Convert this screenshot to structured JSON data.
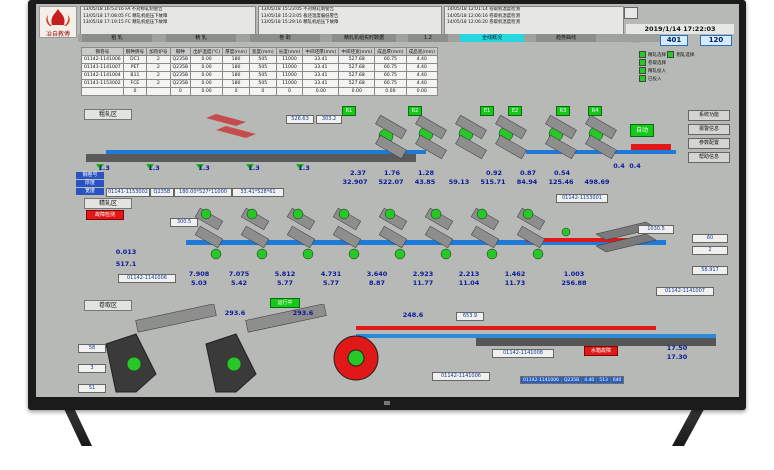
{
  "brand": {
    "logo_text": "冶自教傅"
  },
  "alarms": {
    "col1": [
      "13/05/18 16:53:16 FA 不对称轧制警告",
      "13/05/18 17:08:05 FC 精轧机组压下故障",
      "13/05/18 17:19:15 FC 精轧机组压下故障"
    ],
    "col2": [
      "13/05/18 15:23:05 不对称轧制警告",
      "13/05/18 15:23:05 板坯温度偏低警告",
      "13/05/18 15:29:16 精轧机组压下故障"
    ],
    "col3": [
      "14/05/18 12:01:14 卷取机温度检测",
      "14/05/18 12:06:16 卷取机温度检测",
      "14/05/18 12:06:20 卷取机温度检测"
    ]
  },
  "clock": {
    "date_time": "2019/1/14 17:22:03",
    "label": "计数",
    "count_a": "401",
    "count_b": "120"
  },
  "tabs": [
    {
      "label": "粗 轧",
      "active": false
    },
    {
      "label": "精 轧",
      "active": false
    },
    {
      "label": "卷 取",
      "active": false
    },
    {
      "label": "精轧机组实时数据",
      "active": false
    },
    {
      "label": "1.2",
      "active": false
    },
    {
      "label": "全线概况",
      "active": true
    },
    {
      "label": "趋势曲线",
      "active": false
    }
  ],
  "table": {
    "headers": [
      "钢卷号",
      "钢种牌号",
      "加热炉号",
      "钢种",
      "出炉温度(℃)",
      "厚度(mm)",
      "宽度(mm)",
      "长度(mm)",
      "中间坯厚(mm)",
      "中间坯宽(mm)",
      "成品厚(mm)",
      "成品宽(mm)"
    ],
    "rows": [
      [
        "01142-1141006",
        "DC1",
        "2",
        "Q235B",
        "0.00",
        "180",
        "505",
        "11000",
        "33.41",
        "527.68",
        "60.75",
        "4.40",
        "513.00"
      ],
      [
        "01141-1141007",
        "PET",
        "2",
        "Q235B",
        "0.00",
        "180",
        "505",
        "11000",
        "33.41",
        "527.68",
        "60.75",
        "4.40",
        "513.00"
      ],
      [
        "01142-1141004",
        "B11",
        "2",
        "Q235B",
        "0.00",
        "180",
        "505",
        "11000",
        "33.41",
        "527.68",
        "60.75",
        "4.40",
        "513.00"
      ],
      [
        "01141-1153002",
        "FCE",
        "2",
        "Q235B",
        "0.00",
        "180",
        "505",
        "11000",
        "33.41",
        "527.68",
        "60.75",
        "4.40",
        "513.00"
      ],
      [
        "",
        "0",
        "",
        "0",
        "0.00",
        "0",
        "0",
        "0",
        "0.00",
        "0.00",
        "0.00",
        "0.00",
        "0.00"
      ]
    ]
  },
  "legend": [
    "精轧选择",
    "粗轧选择",
    "卷取选择",
    "精轧投入",
    "已投入"
  ],
  "rough": {
    "section": "粗轧区",
    "head_vals": [
      "526.63",
      "303.2"
    ],
    "stand_tags": [
      "R1",
      "R2",
      "E1",
      "E2",
      "R3",
      "R4"
    ],
    "conv_vals": [
      "1.3",
      "1.3",
      "1.3",
      "1.3",
      "1.3"
    ],
    "values_top": [
      "2.37",
      "1.76",
      "1.28",
      "0.92",
      "0.87",
      "0.54"
    ],
    "values_bot": [
      "32.907",
      "522.07",
      "43.85",
      "59.13",
      "515.71",
      "84.94",
      "125.46",
      "498.69"
    ],
    "right_vals": [
      "0.4",
      "0.4"
    ],
    "auto": "自动",
    "buttons": [
      "系统功能",
      "报警信息",
      "参数配置",
      "帮助信息"
    ],
    "info_labels": [
      "钢卷号",
      "厚度",
      "宽度"
    ],
    "info_vals": [
      "01141-1153002",
      "Q235B",
      "180.00*527*11000",
      "33.41*528*61"
    ]
  },
  "finish": {
    "section": "精轧区",
    "status_red": "故障检测",
    "coil_no": "01142-1153001",
    "temp_in": "300.5",
    "stand_count_labels": [
      "F1",
      "F2",
      "F3",
      "F4",
      "F5",
      "F6",
      "F7"
    ],
    "vals_a": [
      "7.908",
      "7.075",
      "5.812",
      "4.731",
      "3.640",
      "2.923",
      "2.213",
      "1.462"
    ],
    "vals_b": [
      "5.03",
      "5.42",
      "5.77",
      "5.77",
      "8.87",
      "11.77",
      "11.04",
      "11.73"
    ],
    "speed": "1.003",
    "speed2": "256.88",
    "left_vals": [
      "0.013",
      "517.1"
    ],
    "right_temp": "1030.5",
    "right_vals": [
      "60",
      "2",
      "58.917"
    ],
    "coil_in": "01142-1141006",
    "coil_out": "01142-1141007"
  },
  "coil": {
    "section": "卷取区",
    "status_green": "运行中",
    "vals": [
      "293.6",
      "293.6",
      "248.6",
      "653.9"
    ],
    "coil_no": "01142-1141008",
    "left_vals": [
      "58",
      "3",
      "51"
    ],
    "status_red": "水箱故障",
    "meas": [
      "17.50",
      "17.30"
    ],
    "bottom_coil": "01142-1141006",
    "bottom_row": [
      "01142-1141006",
      "Q235B",
      "4.40",
      "513",
      "640"
    ]
  }
}
